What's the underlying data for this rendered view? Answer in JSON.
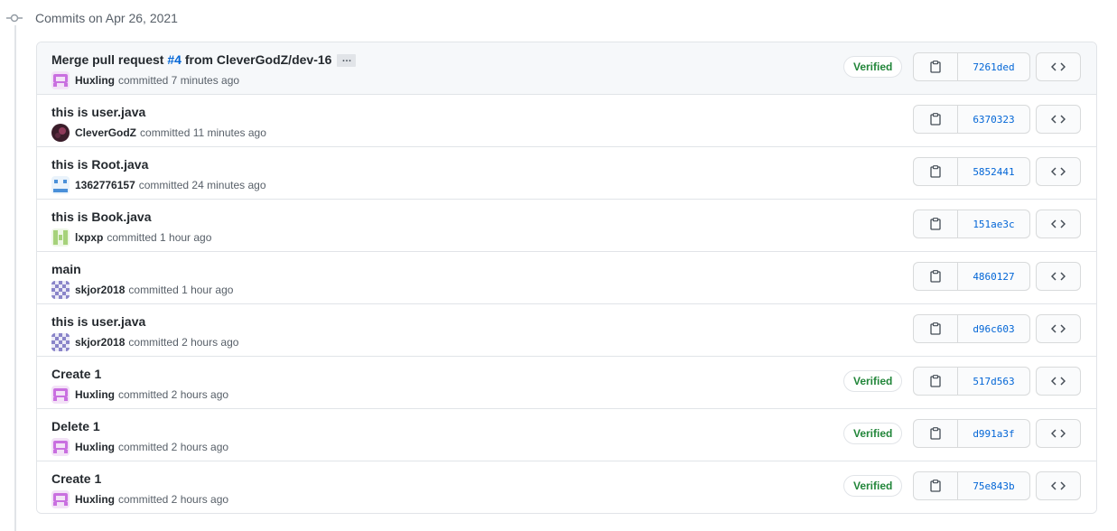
{
  "group": {
    "title": "Commits on Apr 26, 2021"
  },
  "colors": {
    "verified": "#22863a",
    "link": "#0366d6",
    "border": "#e1e4e8"
  },
  "commits": [
    {
      "message_prefix": "Merge pull request ",
      "pr_ref": "#4",
      "message_suffix": " from CleverGodZ/dev-16",
      "has_ellipsis": true,
      "ellipsis_label": "…",
      "author": "Huxling",
      "time": "committed 7 minutes ago",
      "avatar": "huxling",
      "verified": true,
      "verified_label": "Verified",
      "sha": "7261ded"
    },
    {
      "message": "this is user.java",
      "author": "CleverGodZ",
      "time": "committed 11 minutes ago",
      "avatar": "clevergodz",
      "verified": false,
      "sha": "6370323"
    },
    {
      "message": "this is Root.java",
      "author": "1362776157",
      "time": "committed 24 minutes ago",
      "avatar": "1362776157",
      "verified": false,
      "sha": "5852441"
    },
    {
      "message": "this is Book.java",
      "author": "lxpxp",
      "time": "committed 1 hour ago",
      "avatar": "lxpxp",
      "verified": false,
      "sha": "151ae3c"
    },
    {
      "message": "main",
      "author": "skjor2018",
      "time": "committed 1 hour ago",
      "avatar": "skjor2018",
      "verified": false,
      "sha": "4860127"
    },
    {
      "message": "this is user.java",
      "author": "skjor2018",
      "time": "committed 2 hours ago",
      "avatar": "skjor2018",
      "verified": false,
      "sha": "d96c603"
    },
    {
      "message": "Create 1",
      "author": "Huxling",
      "time": "committed 2 hours ago",
      "avatar": "huxling",
      "verified": true,
      "verified_label": "Verified",
      "sha": "517d563"
    },
    {
      "message": "Delete 1",
      "author": "Huxling",
      "time": "committed 2 hours ago",
      "avatar": "huxling",
      "verified": true,
      "verified_label": "Verified",
      "sha": "d991a3f"
    },
    {
      "message": "Create 1",
      "author": "Huxling",
      "time": "committed 2 hours ago",
      "avatar": "huxling",
      "verified": true,
      "verified_label": "Verified",
      "sha": "75e843b"
    }
  ],
  "icons": {
    "copy": "clipboard-icon",
    "browse": "code-icon",
    "timeline": "git-commit-icon"
  }
}
